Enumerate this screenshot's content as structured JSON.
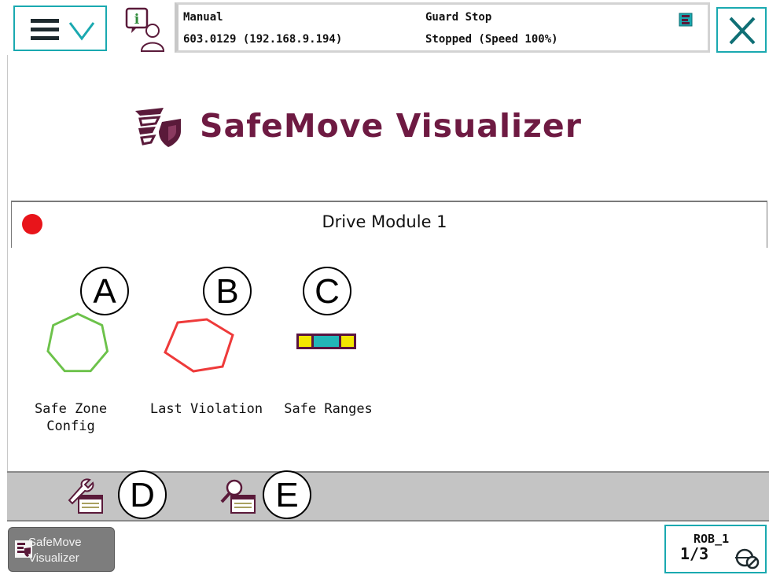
{
  "header": {
    "mode": "Manual",
    "controller": "603.0129 (192.168.9.194)",
    "safety_state": "Guard Stop",
    "run_state": "Stopped (Speed 100%)"
  },
  "app": {
    "title": "SafeMove Visualizer",
    "brand_color": "#6e1a42"
  },
  "drive_module": {
    "label": "Drive Module 1",
    "status_color": "#e8141a"
  },
  "apps": [
    {
      "label_line1": "Safe Zone",
      "label_line2": "Config",
      "callout": "A",
      "icon": "heptagon-green-icon"
    },
    {
      "label_line1": "Last Violation",
      "callout": "B",
      "icon": "hexagon-red-icon"
    },
    {
      "label_line1": "Safe Ranges",
      "callout": "C",
      "icon": "safe-ranges-bar-icon"
    }
  ],
  "toolbar": {
    "tools": [
      {
        "callout": "D",
        "icon": "configure-tool-icon"
      },
      {
        "callout": "E",
        "icon": "search-tool-icon"
      }
    ]
  },
  "taskbar": {
    "task_line1": "SafeMove",
    "task_line2": "Visualizer",
    "rob_label": "ROB_1",
    "rob_fraction": "1/3"
  },
  "colors": {
    "accent": "#1aa9b0",
    "toolbar_bg": "#c4c4c4",
    "zone_green": "#6cc24a",
    "violation_red": "#ee3a3a",
    "range_yellow": "#f3e600",
    "range_teal": "#22b5b8",
    "range_border": "#5a1440"
  }
}
